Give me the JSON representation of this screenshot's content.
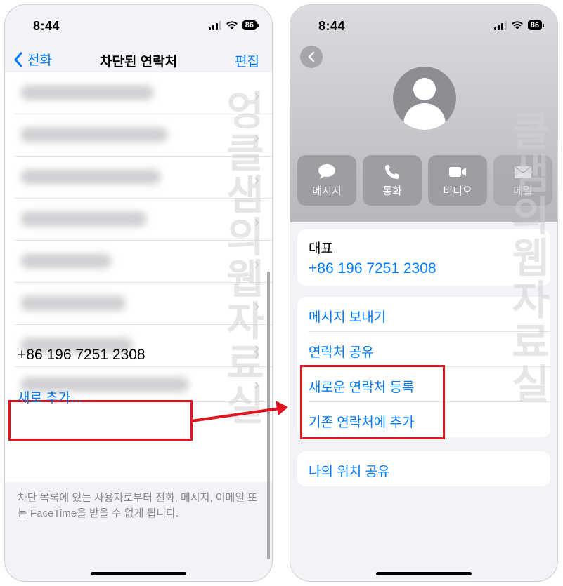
{
  "status_bar": {
    "time": "8:44",
    "battery": "86"
  },
  "left_screen": {
    "nav": {
      "back_label": "전화",
      "title": "차단된 연락처",
      "edit_label": "편집"
    },
    "blocked_number": "+86 196 7251 2308",
    "add_new": "새로 추가...",
    "footer_note": "차단 목록에 있는 사용자로부터 전화, 메시지, 이메일 또는 FaceTime을 받을 수 없게 됩니다."
  },
  "right_screen": {
    "actions": [
      {
        "label": "메시지",
        "icon": "message-icon"
      },
      {
        "label": "통화",
        "icon": "phone-icon"
      },
      {
        "label": "비디오",
        "icon": "video-icon"
      },
      {
        "label": "메일",
        "icon": "mail-icon"
      }
    ],
    "phone_card": {
      "label": "대표",
      "number": "+86 196 7251 2308"
    },
    "options": [
      {
        "label": "메시지 보내기"
      },
      {
        "label": "연락처 공유"
      },
      {
        "label": "새로운 연락처 등록"
      },
      {
        "label": "기존 연락처에 추가"
      }
    ],
    "location_share": "나의 위치 공유"
  },
  "watermark": {
    "left": "엉클샘의웹자료실",
    "right": "클샘의웹자료실"
  },
  "colors": {
    "accent": "#007aff",
    "highlight": "#e0141e"
  }
}
